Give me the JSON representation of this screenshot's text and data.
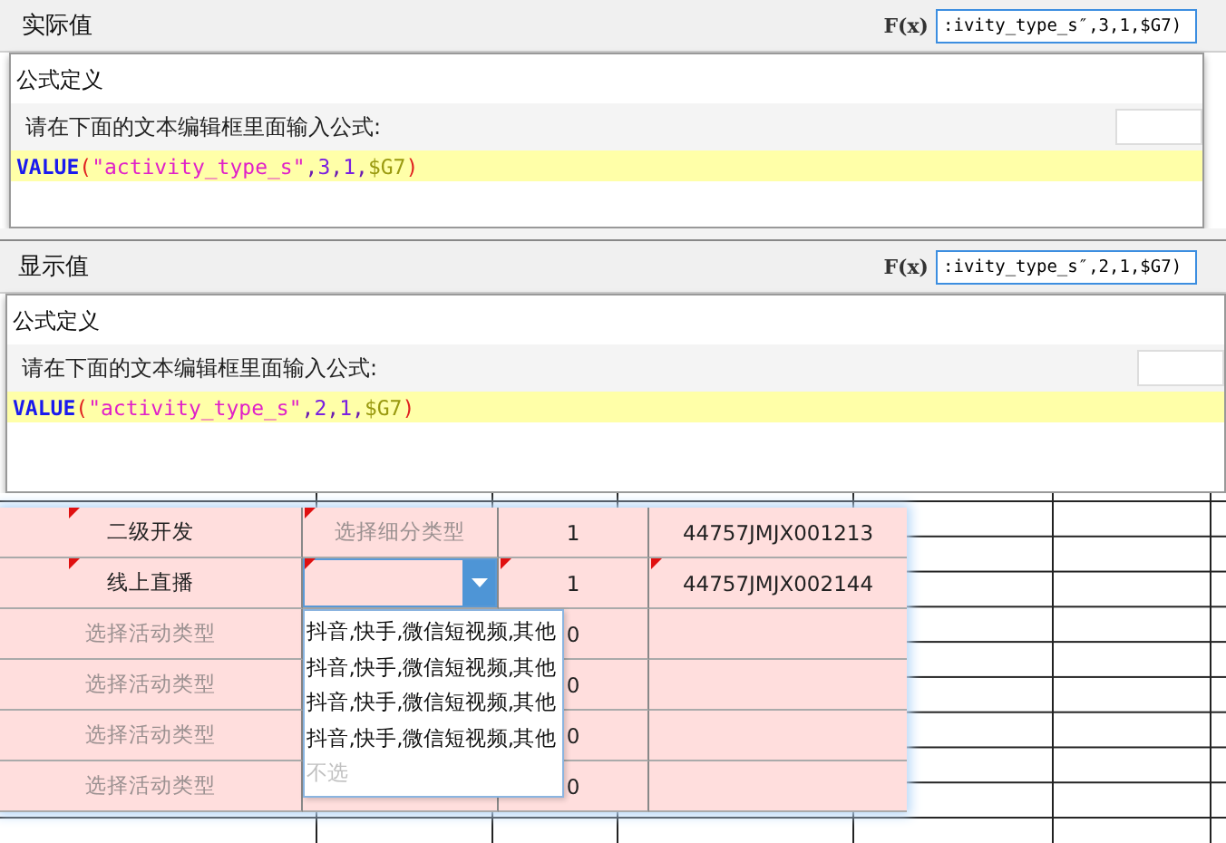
{
  "panels": [
    {
      "label": "实际值",
      "fx_label": "F(x)",
      "formula_preview": ":ivity_type_s″,3,1,$G7)",
      "dialog": {
        "title": "公式定义",
        "prompt": "请在下面的文本编辑框里面输入公式:",
        "formula": [
          {
            "text": "VALUE",
            "kind": "function"
          },
          {
            "text": "(",
            "kind": "paren"
          },
          {
            "text": "\"activity_type_s\"",
            "kind": "string"
          },
          {
            "text": ",",
            "kind": "punct"
          },
          {
            "text": "3",
            "kind": "number"
          },
          {
            "text": ",",
            "kind": "punct"
          },
          {
            "text": "1",
            "kind": "number"
          },
          {
            "text": ",",
            "kind": "punct"
          },
          {
            "text": "$G7",
            "kind": "ref"
          },
          {
            "text": ")",
            "kind": "paren"
          }
        ]
      }
    },
    {
      "label": "显示值",
      "fx_label": "F(x)",
      "formula_preview": ":ivity_type_s″,2,1,$G7)",
      "dialog": {
        "title": "公式定义",
        "prompt": "请在下面的文本编辑框里面输入公式:",
        "formula": [
          {
            "text": "VALUE",
            "kind": "function"
          },
          {
            "text": "(",
            "kind": "paren"
          },
          {
            "text": "\"activity_type_s\"",
            "kind": "string"
          },
          {
            "text": ",",
            "kind": "punct"
          },
          {
            "text": "2",
            "kind": "number"
          },
          {
            "text": ",",
            "kind": "punct"
          },
          {
            "text": "1",
            "kind": "number"
          },
          {
            "text": ",",
            "kind": "punct"
          },
          {
            "text": "$G7",
            "kind": "ref"
          },
          {
            "text": ")",
            "kind": "paren"
          }
        ]
      }
    }
  ],
  "table": {
    "rows": [
      {
        "cells": [
          {
            "text": "二级开发",
            "kind": "value",
            "flagged": true
          },
          {
            "text": "选择细分类型",
            "kind": "placeholder",
            "flagged": true
          },
          {
            "text": "1",
            "kind": "value",
            "flagged": false
          },
          {
            "text": "44757JMJX001213",
            "kind": "value",
            "flagged": false
          }
        ]
      },
      {
        "cells": [
          {
            "text": "线上直播",
            "kind": "value",
            "flagged": true
          },
          {
            "kind": "combo",
            "flagged": true,
            "expanded": true
          },
          {
            "text": "1",
            "kind": "value",
            "flagged": true
          },
          {
            "text": "44757JMJX002144",
            "kind": "value",
            "flagged": true
          }
        ]
      },
      {
        "cells": [
          {
            "text": "选择活动类型",
            "kind": "placeholder",
            "flagged": false
          },
          {
            "kind": "hidden"
          },
          {
            "text": "0",
            "kind": "value",
            "flagged": false
          },
          {
            "kind": "empty",
            "flagged": false
          }
        ]
      },
      {
        "cells": [
          {
            "text": "选择活动类型",
            "kind": "placeholder",
            "flagged": false
          },
          {
            "kind": "hidden"
          },
          {
            "text": "0",
            "kind": "value",
            "flagged": false
          },
          {
            "kind": "empty",
            "flagged": false
          }
        ]
      },
      {
        "cells": [
          {
            "text": "选择活动类型",
            "kind": "placeholder",
            "flagged": false
          },
          {
            "kind": "hidden"
          },
          {
            "text": "0",
            "kind": "value",
            "flagged": false
          },
          {
            "kind": "empty",
            "flagged": false
          }
        ]
      },
      {
        "cells": [
          {
            "text": "选择活动类型",
            "kind": "placeholder",
            "flagged": false
          },
          {
            "kind": "empty",
            "flagged": false
          },
          {
            "text": "0",
            "kind": "value",
            "flagged": false
          },
          {
            "kind": "empty",
            "flagged": false
          }
        ]
      }
    ]
  },
  "dropdown": {
    "options": [
      {
        "text": "抖音,快手,微信短视频,其他",
        "kind": "option"
      },
      {
        "text": "抖音,快手,微信短视频,其他",
        "kind": "option"
      },
      {
        "text": "抖音,快手,微信短视频,其他",
        "kind": "option"
      },
      {
        "text": "抖音,快手,微信短视频,其他",
        "kind": "option"
      },
      {
        "text": "不选",
        "kind": "none"
      }
    ]
  }
}
